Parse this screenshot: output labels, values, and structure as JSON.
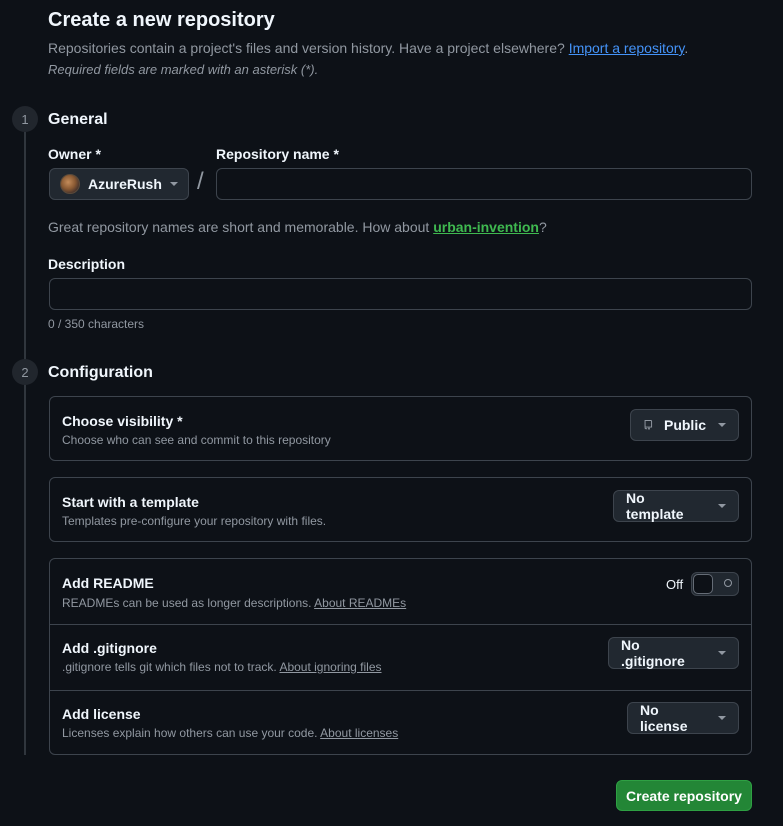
{
  "header": {
    "title": "Create a new repository",
    "subtitle": "Repositories contain a project's files and version history. Have a project elsewhere?",
    "import_link": "Import a repository",
    "subtitle_end": ".",
    "required_note": "Required fields are marked with an asterisk (*)."
  },
  "steps": [
    {
      "number": "1",
      "heading": "General"
    },
    {
      "number": "2",
      "heading": "Configuration"
    }
  ],
  "general": {
    "owner_label": "Owner *",
    "owner_value": "AzureRush",
    "separator": "/",
    "repo_name_label": "Repository name *",
    "repo_name_value": "",
    "hint_prefix": "Great repository names are short and memorable. How about ",
    "hint_suggestion": "urban-invention",
    "hint_suffix": "?",
    "description_label": "Description",
    "description_value": "",
    "description_counter": "0 / 350 characters"
  },
  "configuration": {
    "visibility": {
      "title": "Choose visibility *",
      "desc": "Choose who can see and commit to this repository",
      "value": "Public"
    },
    "template": {
      "title": "Start with a template",
      "desc": "Templates pre-configure your repository with files.",
      "value": "No template"
    },
    "readme": {
      "title": "Add README",
      "desc": "READMEs can be used as longer descriptions.",
      "link": "About READMEs",
      "toggle_label": "Off",
      "toggle_on": false
    },
    "gitignore": {
      "title": "Add .gitignore",
      "desc": ".gitignore tells git which files not to track.",
      "link": "About ignoring files",
      "value": "No .gitignore"
    },
    "license": {
      "title": "Add license",
      "desc": "Licenses explain how others can use your code.",
      "link": "About licenses",
      "value": "No license"
    }
  },
  "actions": {
    "create_label": "Create repository"
  },
  "colors": {
    "background": "#0d1117",
    "accent_link": "#4493f8",
    "suggestion": "#3fb950",
    "primary_button": "#238636"
  }
}
